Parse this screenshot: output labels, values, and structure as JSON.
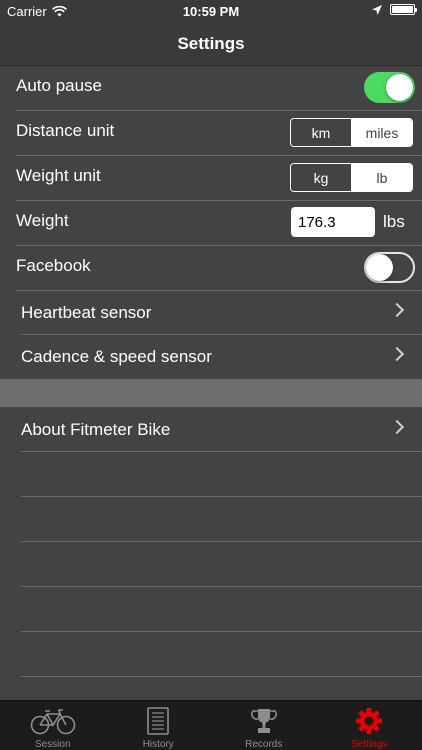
{
  "status_bar": {
    "carrier": "Carrier",
    "time": "10:59 PM"
  },
  "nav": {
    "title": "Settings"
  },
  "settings": {
    "auto_pause": {
      "label": "Auto pause",
      "on": true
    },
    "distance_unit": {
      "label": "Distance unit",
      "options": [
        "km",
        "miles"
      ],
      "selected": "miles"
    },
    "weight_unit": {
      "label": "Weight unit",
      "options": [
        "kg",
        "lb"
      ],
      "selected": "lb"
    },
    "weight": {
      "label": "Weight",
      "value": "176.3",
      "unit": "lbs"
    },
    "facebook": {
      "label": "Facebook",
      "on": false
    },
    "heartbeat_sensor": {
      "label": "Heartbeat sensor"
    },
    "cadence_sensor": {
      "label": "Cadence & speed sensor"
    },
    "about": {
      "label": "About Fitmeter Bike"
    }
  },
  "tabs": [
    {
      "label": "Session",
      "icon": "bicycle-icon"
    },
    {
      "label": "History",
      "icon": "notebook-icon"
    },
    {
      "label": "Records",
      "icon": "trophy-icon"
    },
    {
      "label": "Settings",
      "icon": "gear-icon",
      "active": true
    }
  ],
  "colors": {
    "toggle_on": "#4cd964",
    "active_tab": "#e40000",
    "background": "#434343"
  }
}
